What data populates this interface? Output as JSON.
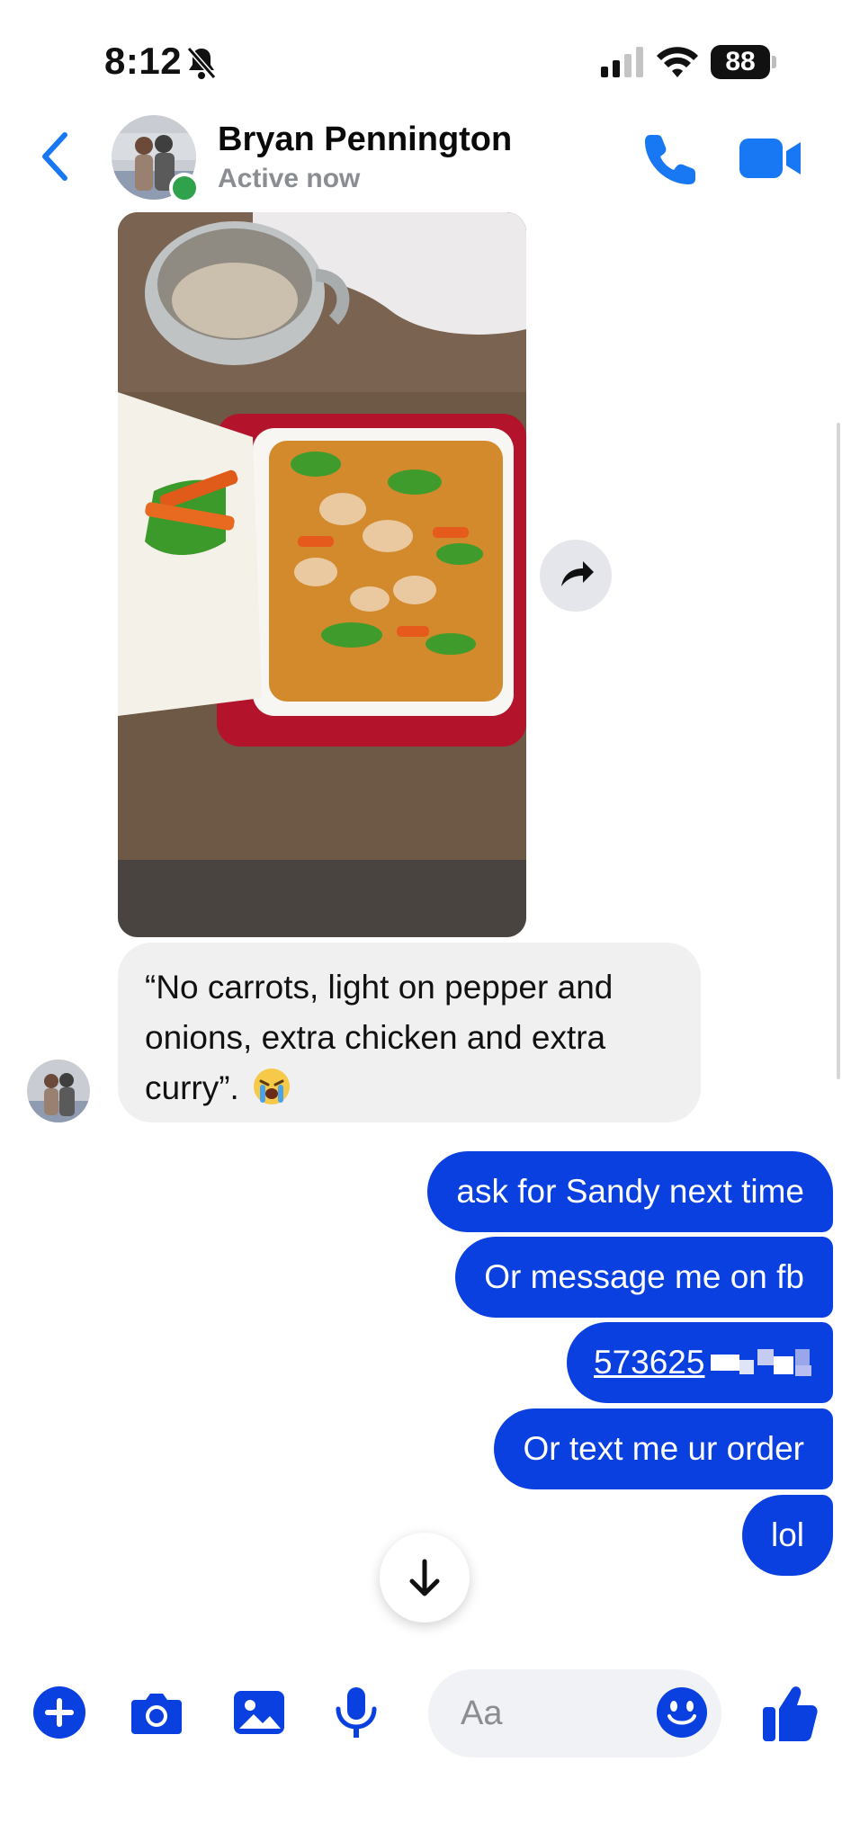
{
  "status_bar": {
    "time": "8:12",
    "battery": "88",
    "icons": [
      "bell-slash-icon",
      "cellular-signal-icon",
      "wifi-icon",
      "battery-icon"
    ]
  },
  "header": {
    "contact_name": "Bryan Pennington",
    "status": "Active now",
    "icons": [
      "chevron-left-icon",
      "phone-icon",
      "video-camera-icon"
    ]
  },
  "thread": {
    "photo": {
      "description_icon": "food-photo",
      "forward_icon": "share-arrow-icon"
    },
    "incoming": {
      "text": "“No carrots, light on pepper and onions, extra chicken and extra curry”.",
      "emoji": "loudly-crying-face"
    },
    "outgoing": [
      {
        "text": "ask for Sandy next time"
      },
      {
        "text": "Or message me on fb"
      },
      {
        "text": "573625",
        "type": "phone-link-redacted"
      },
      {
        "text": "Or text me ur order"
      },
      {
        "text": "lol"
      }
    ]
  },
  "composer": {
    "placeholder": "Aa",
    "icons": [
      "plus-circle-icon",
      "camera-icon",
      "image-icon",
      "microphone-icon",
      "smiley-icon",
      "thumbs-up-icon"
    ]
  },
  "colors": {
    "accent": "#0a3fe0",
    "header_icon_blue": "#1877f2",
    "incoming_bubble": "#f0f0f0",
    "online_green": "#31a24c",
    "muted_text": "#8a8d91"
  }
}
